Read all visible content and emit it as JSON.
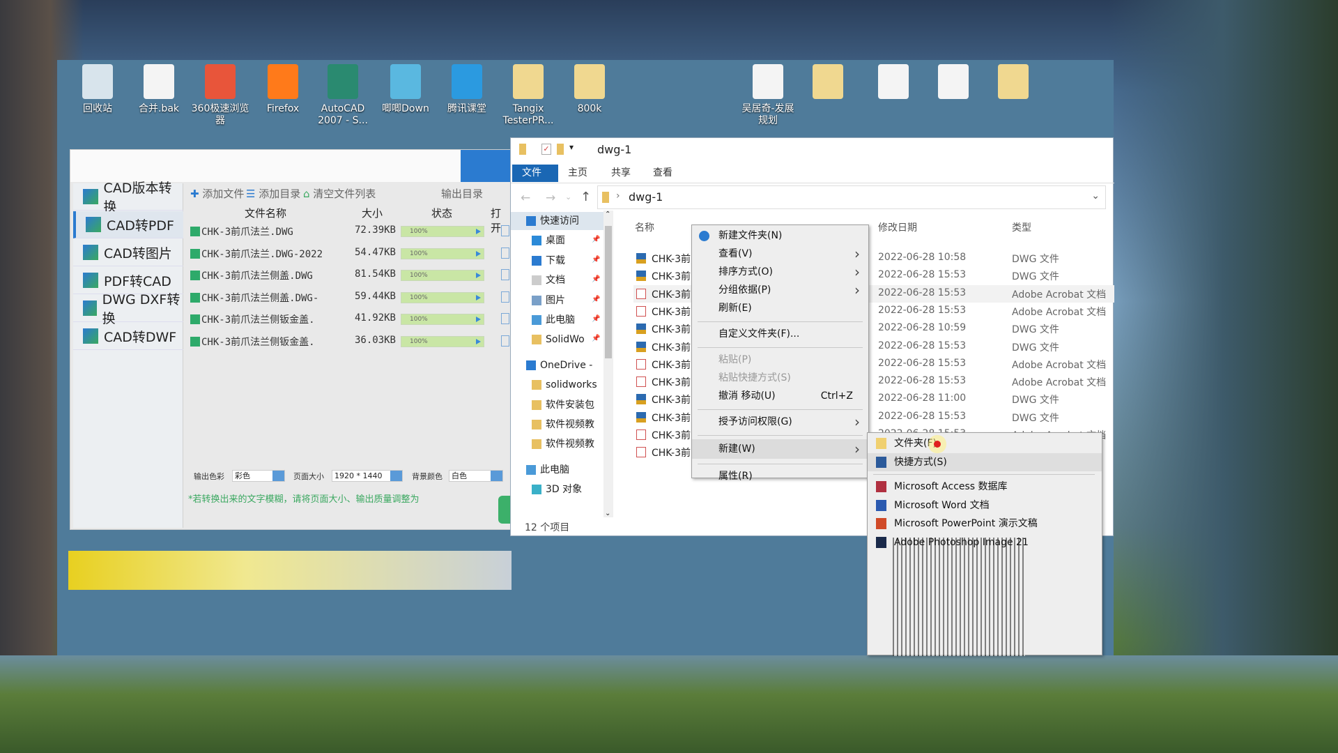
{
  "desktop": {
    "icons": [
      {
        "label": "回收站",
        "icon": "recycle-bin-icon",
        "color": "#d8e4ec"
      },
      {
        "label": "合并.bak",
        "icon": "file-icon",
        "color": "#f4f4f4"
      },
      {
        "label": "360极速浏览器",
        "icon": "360-browser-icon",
        "color": "#e8553a"
      },
      {
        "label": "Firefox",
        "icon": "firefox-icon",
        "color": "#ff7a1a"
      },
      {
        "label": "AutoCAD 2007 - S...",
        "icon": "autocad-icon",
        "color": "#2a8a70"
      },
      {
        "label": "唧唧Down",
        "icon": "jijidown-icon",
        "color": "#5ab8e0"
      },
      {
        "label": "腾讯课堂",
        "icon": "tencent-classroom-icon",
        "color": "#2b9ae0"
      },
      {
        "label": "Tangix TesterPR...",
        "icon": "folder-icon",
        "color": "#f0d890"
      },
      {
        "label": "800k",
        "icon": "folder-icon",
        "color": "#f0d890"
      },
      {
        "label": "吴居奇-发展规划",
        "icon": "word-doc-icon",
        "color": "#f4f4f4"
      },
      {
        "label": "",
        "icon": "folder-icon",
        "color": "#f0d890"
      },
      {
        "label": "",
        "icon": "file-icon",
        "color": "#f4f4f4"
      },
      {
        "label": "",
        "icon": "file-icon",
        "color": "#f4f4f4"
      },
      {
        "label": "",
        "icon": "folder-icon",
        "color": "#f0d890"
      }
    ]
  },
  "cad": {
    "sidebar": [
      "CAD版本转换",
      "CAD转PDF",
      "CAD转图片",
      "PDF转CAD",
      "DWG DXF转换",
      "CAD转DWF"
    ],
    "selected": 1,
    "toolbar": {
      "add_file": "添加文件",
      "add_dir": "添加目录",
      "clear": "清空文件列表",
      "output_dir": "输出目录"
    },
    "columns": {
      "name": "文件名称",
      "size": "大小",
      "status": "状态",
      "open": "打开"
    },
    "files": [
      {
        "name": "CHK-3前爪法兰.DWG",
        "size": "72.39KB",
        "progress": "100%"
      },
      {
        "name": "CHK-3前爪法兰.DWG-2022",
        "size": "54.47KB",
        "progress": "100%"
      },
      {
        "name": "CHK-3前爪法兰侧盖.DWG",
        "size": "81.54KB",
        "progress": "100%"
      },
      {
        "name": "CHK-3前爪法兰侧盖.DWG-",
        "size": "59.44KB",
        "progress": "100%"
      },
      {
        "name": "CHK-3前爪法兰侧钣金盖.",
        "size": "41.92KB",
        "progress": "100%"
      },
      {
        "name": "CHK-3前爪法兰侧钣金盖.",
        "size": "36.03KB",
        "progress": "100%"
      }
    ],
    "options": {
      "color_label": "输出色彩",
      "color_value": "彩色",
      "page_label": "页面大小",
      "page_value": "1920 * 1440",
      "bg_label": "背景颜色",
      "bg_value": "白色"
    },
    "hint": "*若转换出来的文字模糊，请将页面大小、输出质量调整为"
  },
  "explorer": {
    "title": "dwg-1",
    "tabs": [
      "文件",
      "主页",
      "共享",
      "查看"
    ],
    "address": "dwg-1",
    "nav": [
      {
        "label": "快速访问",
        "icon": "star-icon",
        "indent": 0,
        "pin": false
      },
      {
        "label": "桌面",
        "icon": "desktop-icon",
        "indent": 1,
        "pin": true
      },
      {
        "label": "下载",
        "icon": "download-icon",
        "indent": 1,
        "pin": true
      },
      {
        "label": "文档",
        "icon": "documents-icon",
        "indent": 1,
        "pin": true
      },
      {
        "label": "图片",
        "icon": "pictures-icon",
        "indent": 1,
        "pin": true
      },
      {
        "label": "此电脑",
        "icon": "computer-icon",
        "indent": 1,
        "pin": true
      },
      {
        "label": "SolidWo",
        "icon": "folder-icon",
        "indent": 1,
        "pin": true
      },
      {
        "label": "OneDrive -",
        "icon": "onedrive-icon",
        "indent": 0,
        "pin": false
      },
      {
        "label": "solidworks",
        "icon": "folder-icon",
        "indent": 1,
        "pin": false
      },
      {
        "label": "软件安装包",
        "icon": "folder-icon",
        "indent": 1,
        "pin": false
      },
      {
        "label": "软件视频教",
        "icon": "folder-icon",
        "indent": 1,
        "pin": false
      },
      {
        "label": "软件视频教",
        "icon": "folder-icon",
        "indent": 1,
        "pin": false
      },
      {
        "label": "此电脑",
        "icon": "computer-icon",
        "indent": 0,
        "pin": false
      },
      {
        "label": "3D 对象",
        "icon": "3d-objects-icon",
        "indent": 1,
        "pin": false
      }
    ],
    "columns": {
      "name": "名称",
      "date": "修改日期",
      "type": "类型"
    },
    "files": [
      {
        "name": "CHK-3前",
        "date": "2022-06-28 10:58",
        "type": "DWG 文件",
        "kind": "dwg"
      },
      {
        "name": "CHK-3前",
        "date": "2022-06-28 15:53",
        "type": "DWG 文件",
        "kind": "dwg"
      },
      {
        "name": "CHK-3前",
        "date": "2022-06-28 15:53",
        "type": "Adobe Acrobat 文档",
        "kind": "pdf"
      },
      {
        "name": "CHK-3前",
        "date": "2022-06-28 15:53",
        "type": "Adobe Acrobat 文档",
        "kind": "pdf"
      },
      {
        "name": "CHK-3前",
        "date": "2022-06-28 10:59",
        "type": "DWG 文件",
        "kind": "dwg"
      },
      {
        "name": "CHK-3前",
        "date": "2022-06-28 15:53",
        "type": "DWG 文件",
        "kind": "dwg"
      },
      {
        "name": "CHK-3前",
        "date": "2022-06-28 15:53",
        "type": "Adobe Acrobat 文档",
        "kind": "pdf"
      },
      {
        "name": "CHK-3前",
        "date": "2022-06-28 15:53",
        "type": "Adobe Acrobat 文档",
        "kind": "pdf"
      },
      {
        "name": "CHK-3前",
        "date": "2022-06-28 11:00",
        "type": "DWG 文件",
        "kind": "dwg"
      },
      {
        "name": "CHK-3前",
        "date": "2022-06-28 15:53",
        "type": "DWG 文件",
        "kind": "dwg"
      },
      {
        "name": "CHK-3前",
        "date": "2022-06-28 15:53",
        "type": "Adobe Acrobat 文档",
        "kind": "pdf"
      },
      {
        "name": "CHK-3前",
        "date": "",
        "type": "",
        "kind": "pdf"
      }
    ],
    "status": "12 个项目"
  },
  "context_menu": {
    "items": [
      {
        "label": "新建文件夹(N)",
        "icon": "new-folder-icon"
      },
      {
        "label": "查看(V)",
        "submenu": true
      },
      {
        "label": "排序方式(O)",
        "submenu": true
      },
      {
        "label": "分组依据(P)",
        "submenu": true
      },
      {
        "label": "刷新(E)"
      },
      {
        "sep": true
      },
      {
        "label": "自定义文件夹(F)..."
      },
      {
        "sep": true
      },
      {
        "label": "粘贴(P)",
        "disabled": true
      },
      {
        "label": "粘贴快捷方式(S)",
        "disabled": true
      },
      {
        "label": "撤消 移动(U)",
        "shortcut": "Ctrl+Z"
      },
      {
        "sep": true
      },
      {
        "label": "授予访问权限(G)",
        "submenu": true
      },
      {
        "sep": true
      },
      {
        "label": "新建(W)",
        "submenu": true,
        "hover": true
      },
      {
        "sep": true
      },
      {
        "label": "属性(R)"
      }
    ]
  },
  "new_submenu": {
    "items": [
      {
        "label": "文件夹(F)",
        "icon": "folder-icon",
        "color": "#f0d070"
      },
      {
        "label": "快捷方式(S)",
        "icon": "shortcut-icon",
        "color": "#2b5a9a",
        "hover": true
      },
      {
        "sep": true
      },
      {
        "label": "Microsoft Access 数据库",
        "icon": "access-icon",
        "color": "#b03040"
      },
      {
        "label": "Microsoft Word 文档",
        "icon": "word-icon",
        "color": "#2b5ab0"
      },
      {
        "label": "Microsoft PowerPoint 演示文稿",
        "icon": "powerpoint-icon",
        "color": "#d04a28"
      },
      {
        "label": "Adobe Photoshop Image 21",
        "icon": "photoshop-icon",
        "color": "#1a2a4a"
      }
    ]
  }
}
